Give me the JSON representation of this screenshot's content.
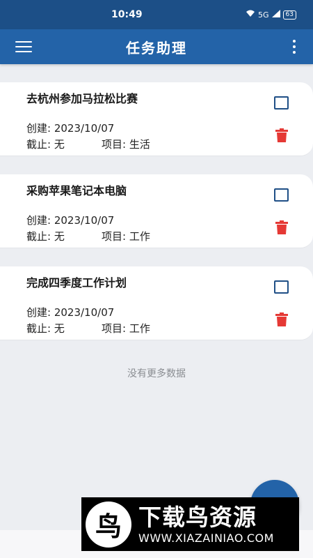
{
  "status_bar": {
    "time": "10:49",
    "icons": [
      "wifi-icon",
      "bluetooth-icon",
      "signal-icon"
    ],
    "network": "5G",
    "battery": "63"
  },
  "app_bar": {
    "title": "任务助理"
  },
  "tasks": [
    {
      "name": "去杭州参加马拉松比赛",
      "created": "创建: 2023/10/07",
      "due": "截止: 无",
      "project": "项目: 生活"
    },
    {
      "name": "采购苹果笔记本电脑",
      "created": "创建: 2023/10/07",
      "due": "截止: 无",
      "project": "项目: 工作"
    },
    {
      "name": "完成四季度工作计划",
      "created": "创建: 2023/10/07",
      "due": "截止: 无",
      "project": "项目: 工作"
    }
  ],
  "list_footer": "没有更多数据",
  "watermark": {
    "logo_char": "鸟",
    "title": "下载鸟资源",
    "url": "WWW.XIAZAINIAO.COM"
  },
  "colors": {
    "status_bar": "#1c4f87",
    "app_bar": "#2363a8",
    "delete": "#e53935",
    "checkbox": "#1f4f86"
  }
}
